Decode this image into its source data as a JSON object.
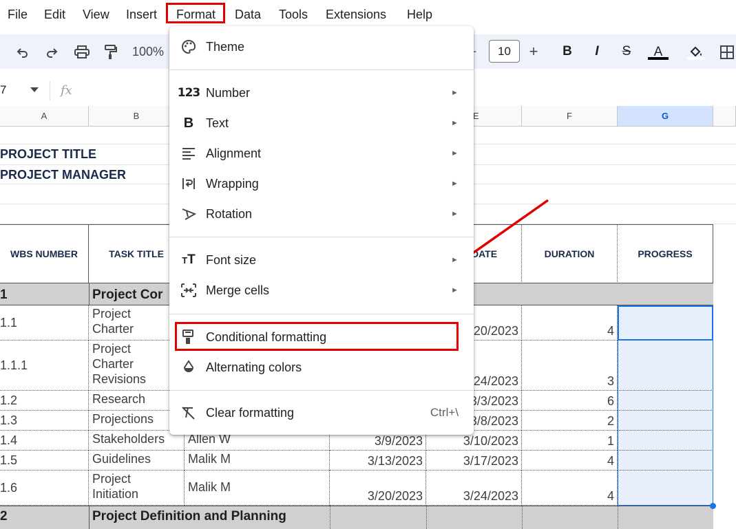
{
  "menubar": {
    "items": [
      "File",
      "Edit",
      "View",
      "Insert",
      "Format",
      "Data",
      "Tools",
      "Extensions",
      "Help"
    ]
  },
  "toolbar": {
    "zoom": "100%",
    "font_size": "10"
  },
  "formula_bar": {
    "cell_ref": "7",
    "fx": "fx"
  },
  "columns": [
    "A",
    "B",
    "E",
    "F",
    "G"
  ],
  "sheet": {
    "project_title": "PROJECT TITLE",
    "project_manager": "PROJECT MANAGER",
    "headers": {
      "wbs": "WBS NUMBER",
      "task": "TASK TITLE",
      "date": "DATE",
      "duration": "DURATION",
      "progress": "PROGRESS"
    },
    "section1": {
      "wbs": "1",
      "title": "Project Cor"
    },
    "section2": {
      "wbs": "2",
      "title": "Project Definition and Planning"
    },
    "rows": [
      {
        "wbs": "1.1",
        "task1": "Project",
        "task2": "Charter",
        "task3": "",
        "owner": "",
        "start": "",
        "end": "20/2023",
        "duration": "4"
      },
      {
        "wbs": "1.1.1",
        "task1": "Project",
        "task2": "Charter",
        "task3": "Revisions",
        "owner": "",
        "start": "",
        "end": "24/2023",
        "duration": "3"
      },
      {
        "wbs": "1.2",
        "task1": "Research",
        "task2": "",
        "task3": "",
        "owner": "",
        "start": "",
        "end": "3/3/2023",
        "duration": "6"
      },
      {
        "wbs": "1.3",
        "task1": "Projections",
        "task2": "",
        "task3": "",
        "owner": "",
        "start": "",
        "end": "3/8/2023",
        "duration": "2"
      },
      {
        "wbs": "1.4",
        "task1": "Stakeholders",
        "task2": "",
        "task3": "",
        "owner": "Allen W",
        "start": "3/9/2023",
        "end": "3/10/2023",
        "duration": "1"
      },
      {
        "wbs": "1.5",
        "task1": "Guidelines",
        "task2": "",
        "task3": "",
        "owner": "Malik M",
        "start": "3/13/2023",
        "end": "3/17/2023",
        "duration": "4"
      },
      {
        "wbs": "1.6",
        "task1": "Project",
        "task2": "Initiation",
        "task3": "",
        "owner": "Malik M",
        "start": "3/20/2023",
        "end": "3/24/2023",
        "duration": "4"
      }
    ]
  },
  "format_menu": {
    "theme": "Theme",
    "number": "Number",
    "text": "Text",
    "alignment": "Alignment",
    "wrapping": "Wrapping",
    "rotation": "Rotation",
    "font_size": "Font size",
    "merge_cells": "Merge cells",
    "conditional_formatting": "Conditional formatting",
    "alternating_colors": "Alternating colors",
    "clear_formatting": "Clear formatting",
    "clear_shortcut": "Ctrl+\\",
    "number_icon": "123"
  },
  "colors": {
    "highlight_red": "#e00000",
    "selection_blue": "#1a73e8",
    "section_gray": "#d0d0d0",
    "header_navy": "#1b2a4a"
  }
}
